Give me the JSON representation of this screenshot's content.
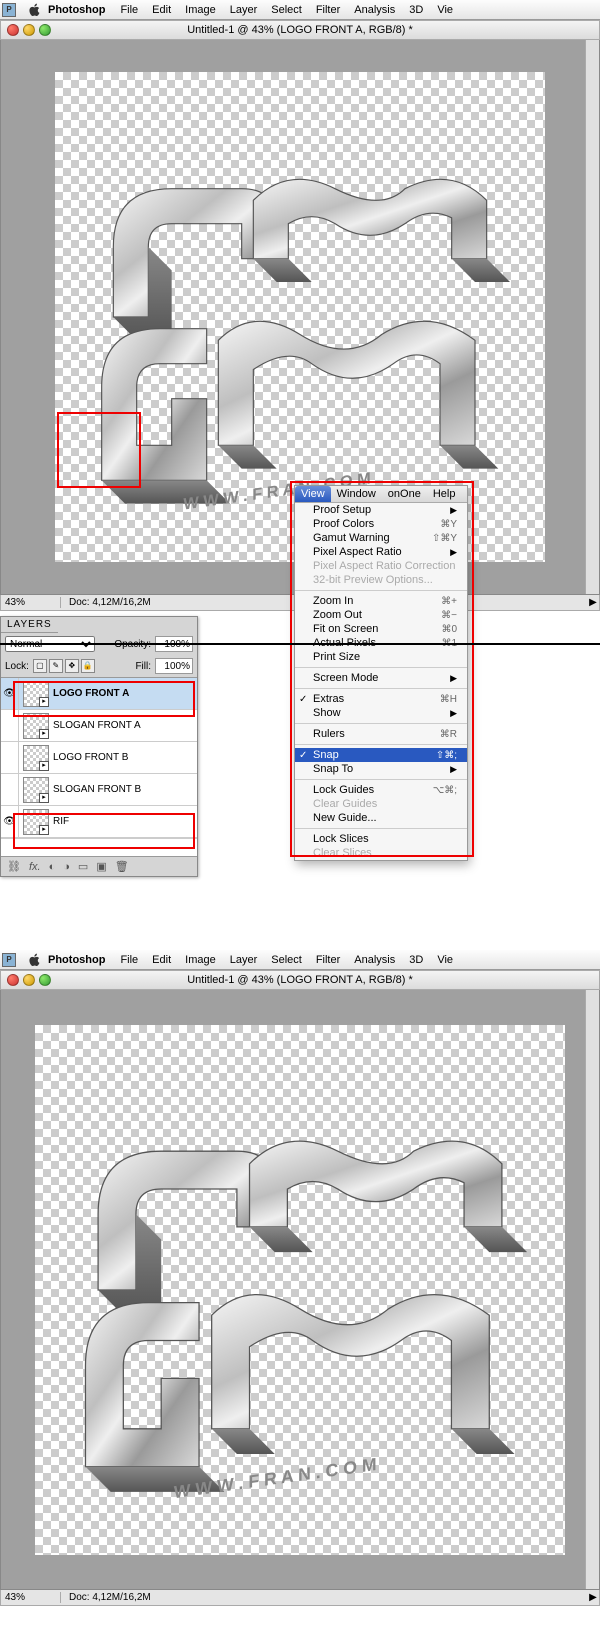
{
  "menubar": {
    "appname": "Photoshop",
    "items": [
      "File",
      "Edit",
      "Image",
      "Layer",
      "Select",
      "Filter",
      "Analysis",
      "3D",
      "Vie"
    ]
  },
  "window": {
    "title": "Untitled-1 @ 43% (LOGO FRONT A, RGB/8) *"
  },
  "statusbar": {
    "zoom": "43%",
    "doc": "Doc: 4,12M/16,2M"
  },
  "layers_panel": {
    "tab": "LAYERS",
    "blend_mode": "Normal",
    "opacity_label": "Opacity:",
    "opacity_value": "100%",
    "lock_label": "Lock:",
    "fill_label": "Fill:",
    "fill_value": "100%",
    "layers": [
      {
        "name": "LOGO FRONT A",
        "selected": true,
        "visible": true
      },
      {
        "name": "SLOGAN FRONT A",
        "selected": false,
        "visible": false
      },
      {
        "name": "LOGO FRONT B",
        "selected": false,
        "visible": false
      },
      {
        "name": "SLOGAN FRONT B",
        "selected": false,
        "visible": false
      },
      {
        "name": "RIF",
        "selected": false,
        "visible": true
      }
    ]
  },
  "context_menu": {
    "titlebar": [
      "View",
      "Window",
      "onOne",
      "Help"
    ],
    "sections": [
      [
        {
          "label": "Proof Setup",
          "arrow": true
        },
        {
          "label": "Proof Colors",
          "shortcut": "⌘Y"
        },
        {
          "label": "Gamut Warning",
          "shortcut": "⇧⌘Y"
        },
        {
          "label": "Pixel Aspect Ratio",
          "arrow": true
        },
        {
          "label": "Pixel Aspect Ratio Correction",
          "disabled": true
        },
        {
          "label": "32-bit Preview Options...",
          "disabled": true
        }
      ],
      [
        {
          "label": "Zoom In",
          "shortcut": "⌘+"
        },
        {
          "label": "Zoom Out",
          "shortcut": "⌘−"
        },
        {
          "label": "Fit on Screen",
          "shortcut": "⌘0"
        },
        {
          "label": "Actual Pixels",
          "shortcut": "⌘1"
        },
        {
          "label": "Print Size"
        }
      ],
      [
        {
          "label": "Screen Mode",
          "arrow": true
        }
      ],
      [
        {
          "label": "Extras",
          "shortcut": "⌘H",
          "check": true
        },
        {
          "label": "Show",
          "arrow": true
        }
      ],
      [
        {
          "label": "Rulers",
          "shortcut": "⌘R"
        }
      ],
      [
        {
          "label": "Snap",
          "shortcut": "⇧⌘;",
          "check": true,
          "highlighted": true
        },
        {
          "label": "Snap To",
          "arrow": true
        }
      ],
      [
        {
          "label": "Lock Guides",
          "shortcut": "⌥⌘;"
        },
        {
          "label": "Clear Guides",
          "disabled": true
        },
        {
          "label": "New Guide..."
        }
      ],
      [
        {
          "label": "Lock Slices"
        },
        {
          "label": "Clear Slices",
          "disabled": true
        }
      ]
    ]
  }
}
